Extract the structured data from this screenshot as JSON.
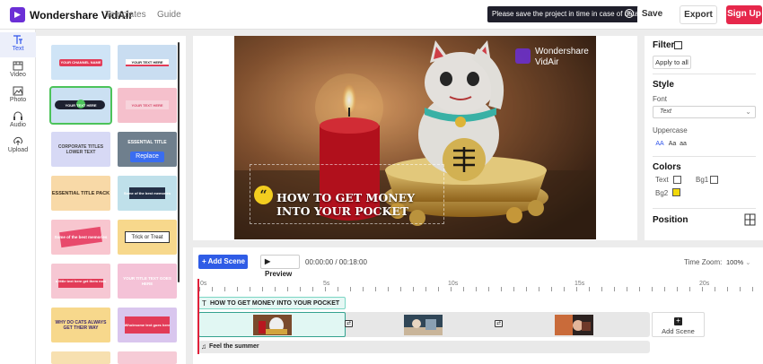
{
  "app": {
    "name": "Wondershare VidAir",
    "brand_color": "#6b2fd6"
  },
  "nav": {
    "templates": "Templates",
    "guide": "Guide"
  },
  "notice": {
    "text": "Please save the project in time in case of data loss.",
    "close": "x"
  },
  "actions": {
    "save": "Save",
    "export": "Export",
    "signup": "Sign Up",
    "signup_color": "#e6274b"
  },
  "rail": [
    {
      "label": "Text",
      "icon": "text-icon",
      "active": true
    },
    {
      "label": "Video",
      "icon": "video-icon"
    },
    {
      "label": "Photo",
      "icon": "photo-icon"
    },
    {
      "label": "Audio",
      "icon": "audio-icon"
    },
    {
      "label": "Upload",
      "icon": "upload-icon"
    }
  ],
  "templates": [
    {
      "label": "YOUR CHANNEL NAME"
    },
    {
      "label": "YOUR TEXT HERE"
    },
    {
      "label": "YOUR TEXT HERE",
      "selected": true
    },
    {
      "label": "YOUR TEXT HERE"
    },
    {
      "label": "CORPORATE TITLES LOWER TEXT"
    },
    {
      "label": "ESSENTIAL TITLE",
      "replace": "Replace"
    },
    {
      "label": "ESSENTIAL TITLE PACK"
    },
    {
      "label": "Some of the best memories"
    },
    {
      "label": "Some of the best memories"
    },
    {
      "label": "Trick or Treat"
    },
    {
      "label": "a little text here get them now"
    },
    {
      "label": "YOUR TITLE TEXT GOES HERE"
    },
    {
      "label": "WHY DO CATS ALWAYS GET THEIR WAY"
    },
    {
      "label": "Wholesome text goes here"
    }
  ],
  "preview": {
    "watermark_line1": "Wondershare",
    "watermark_line2": "VidAir",
    "caption_line1": "HOW TO GET MONEY",
    "caption_line2": "INTO YOUR POCKET",
    "caption_icon": "“"
  },
  "props": {
    "filter": "Filter",
    "apply_all": "Apply to all",
    "style": "Style",
    "font_label": "Font",
    "font_value": "Text",
    "uppercase": "Uppercase",
    "case_options": [
      "AA",
      "Aa",
      "aa"
    ],
    "colors": "Colors",
    "color_text": "Text",
    "color_bg1": "Bg1",
    "color_bg2": "Bg2",
    "position": "Position"
  },
  "timeline": {
    "add_scene": "Add Scene",
    "preview": "Preview",
    "timecode": "00:00:00 / 00:18:00",
    "zoom_label": "Time Zoom:",
    "zoom_value": "100%",
    "ruler": [
      "0s",
      "5s",
      "10s",
      "15s",
      "20s"
    ],
    "text_clip": "HOW TO GET MONEY INTO YOUR POCKET",
    "audio_clip": "Feel the summer",
    "add_scene_slot": "Add Scene"
  }
}
